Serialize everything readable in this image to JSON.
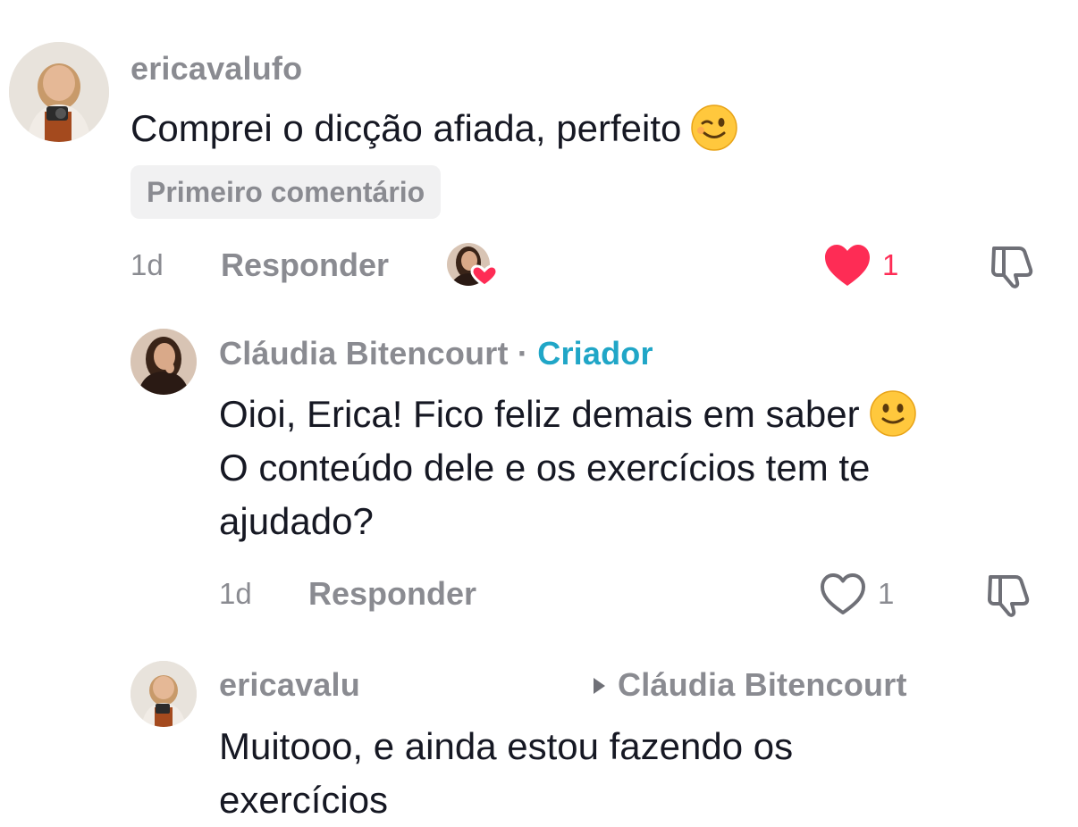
{
  "comments": [
    {
      "username": "ericavalufo",
      "text": "Comprei o dicção afiada, perfeito",
      "emoji": "winking-face",
      "badge": "Primeiro comentário",
      "time": "1d",
      "reply_label": "Responder",
      "creator_liked": true,
      "liked": true,
      "like_count": "1"
    },
    {
      "username": "Cláudia Bitencourt",
      "separator": "·",
      "creator_label": "Criador",
      "text_line1": "Oioi, Erica! Fico feliz demais em saber",
      "emoji": "slightly-smiling-face",
      "text_rest": "O conteúdo dele e os exercícios tem te ajudado?",
      "time": "1d",
      "reply_label": "Responder",
      "liked": false,
      "like_count": "1"
    },
    {
      "username": "ericavalu",
      "reply_to": "Cláudia Bitencourt",
      "text": "Muitooo, e ainda estou fazendo os exercícios"
    }
  ],
  "colors": {
    "like_active": "#fe2c55",
    "creator_tag": "#20a6c7",
    "muted_text": "#8a8b91",
    "text": "#161823",
    "badge_bg": "#f1f1f2"
  }
}
